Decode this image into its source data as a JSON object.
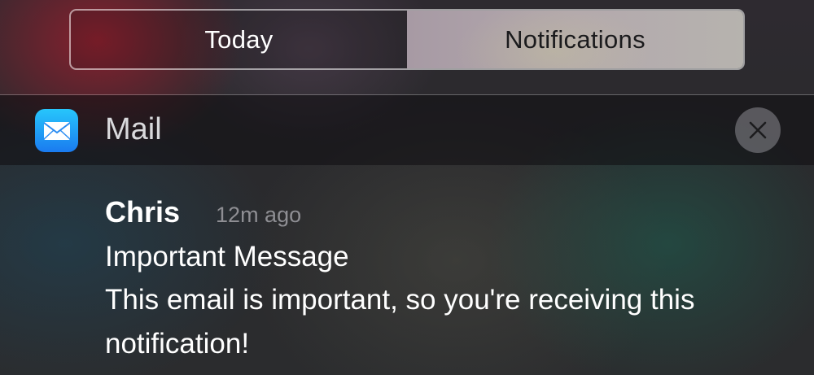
{
  "tabs": {
    "today_label": "Today",
    "notifications_label": "Notifications",
    "selected": "Notifications"
  },
  "app": {
    "name": "Mail",
    "icon": "envelope-icon",
    "icon_color": "#1a9bf5",
    "clear_icon": "close-icon"
  },
  "notification": {
    "sender": "Chris",
    "time": "12m ago",
    "subject": "Important Message",
    "body": "This email is important, so you're receiving this notification!"
  }
}
